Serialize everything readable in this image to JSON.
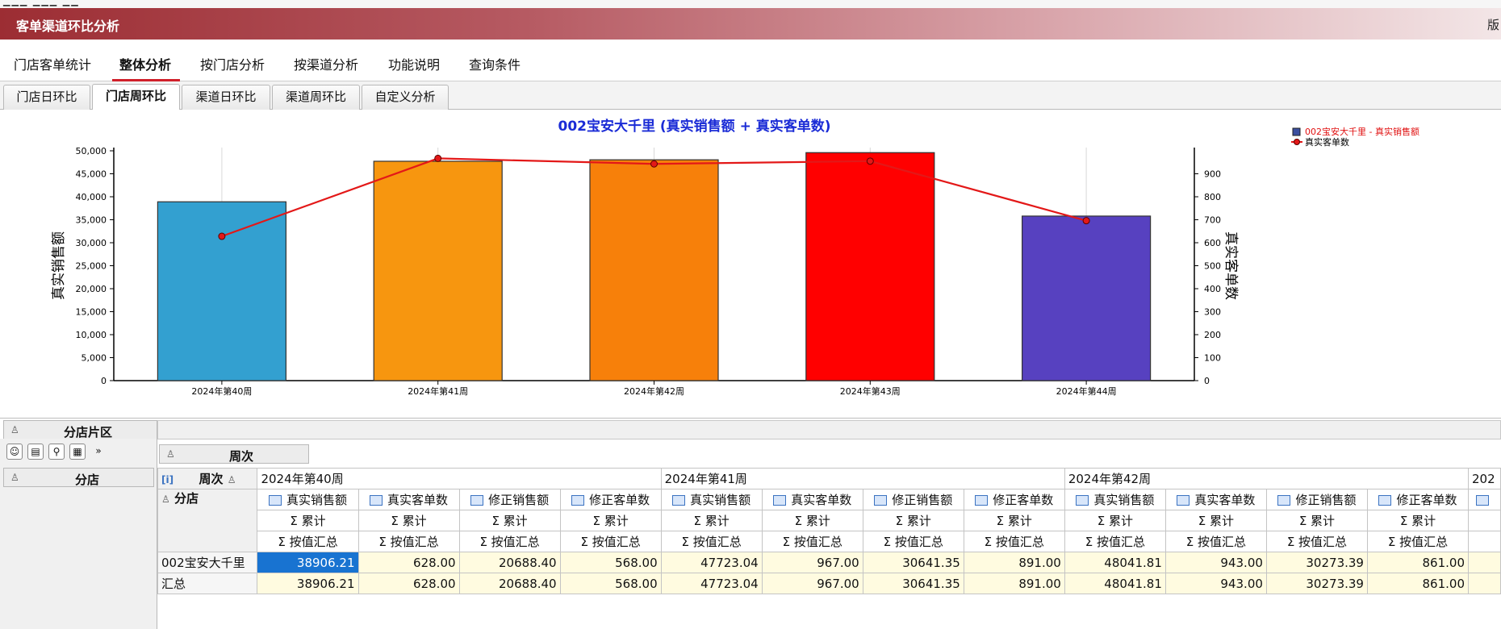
{
  "window": {
    "title": "客单渠道环比分析",
    "right_label": "版"
  },
  "menu": {
    "items": [
      {
        "label": "门店客单统计"
      },
      {
        "label": "整体分析"
      },
      {
        "label": "按门店分析"
      },
      {
        "label": "按渠道分析"
      },
      {
        "label": "功能说明"
      },
      {
        "label": "查询条件"
      }
    ],
    "active": "整体分析"
  },
  "subtabs": {
    "items": [
      {
        "label": "门店日环比"
      },
      {
        "label": "门店周环比"
      },
      {
        "label": "渠道日环比"
      },
      {
        "label": "渠道周环比"
      },
      {
        "label": "自定义分析"
      }
    ],
    "active": "门店周环比"
  },
  "chart_data": {
    "type": "bar",
    "title": "002宝安大千里 (真实销售额 + 真实客单数)",
    "categories": [
      "2024年第40周",
      "2024年第41周",
      "2024年第42周",
      "2024年第43周",
      "2024年第44周"
    ],
    "series": [
      {
        "name": "002宝安大千里 - 真实销售额",
        "type": "bar",
        "axis": "left",
        "values": [
          38906.21,
          47723.04,
          48041.81,
          49600,
          35800
        ]
      },
      {
        "name": "真实客单数",
        "type": "line",
        "axis": "right",
        "values": [
          628,
          967,
          943,
          955,
          696
        ]
      }
    ],
    "bar_colors": [
      "#33a0d0",
      "#f7960f",
      "#f7800a",
      "#ff0000",
      "#5741c0"
    ],
    "line_color": "#e31818",
    "ylabel": "真实销售额",
    "ylabel_right": "真实客单数",
    "ylim": [
      0,
      50000
    ],
    "yticks": [
      "0",
      "5,000",
      "10,000",
      "15,000",
      "20,000",
      "25,000",
      "30,000",
      "35,000",
      "40,000",
      "45,000",
      "50,000"
    ],
    "ylim_right": [
      0,
      1000
    ],
    "yticks_right": [
      "0",
      "100",
      "200",
      "300",
      "400",
      "500",
      "600",
      "700",
      "800",
      "900"
    ],
    "legend": "top-right",
    "grid": false
  },
  "pivot": {
    "filter_field": "分店片区",
    "column_field": "周次",
    "row_field": "分店",
    "week_header_label": "周次",
    "row_header_label": "分店",
    "weeks": [
      "2024年第40周",
      "2024年第41周",
      "2024年第42周",
      "202"
    ],
    "measures": [
      "真实销售额",
      "真实客单数",
      "修正销售额",
      "修正客单数"
    ],
    "sub1": "Σ 累计",
    "sub2": "Σ 按值汇总",
    "rows": [
      {
        "label": "002宝安大千里",
        "values": [
          "38906.21",
          "628.00",
          "20688.40",
          "568.00",
          "47723.04",
          "967.00",
          "30641.35",
          "891.00",
          "48041.81",
          "943.00",
          "30273.39",
          "861.00"
        ]
      },
      {
        "label": "汇总",
        "values": [
          "38906.21",
          "628.00",
          "20688.40",
          "568.00",
          "47723.04",
          "967.00",
          "30641.35",
          "891.00",
          "48041.81",
          "943.00",
          "30273.39",
          "861.00"
        ]
      }
    ]
  }
}
